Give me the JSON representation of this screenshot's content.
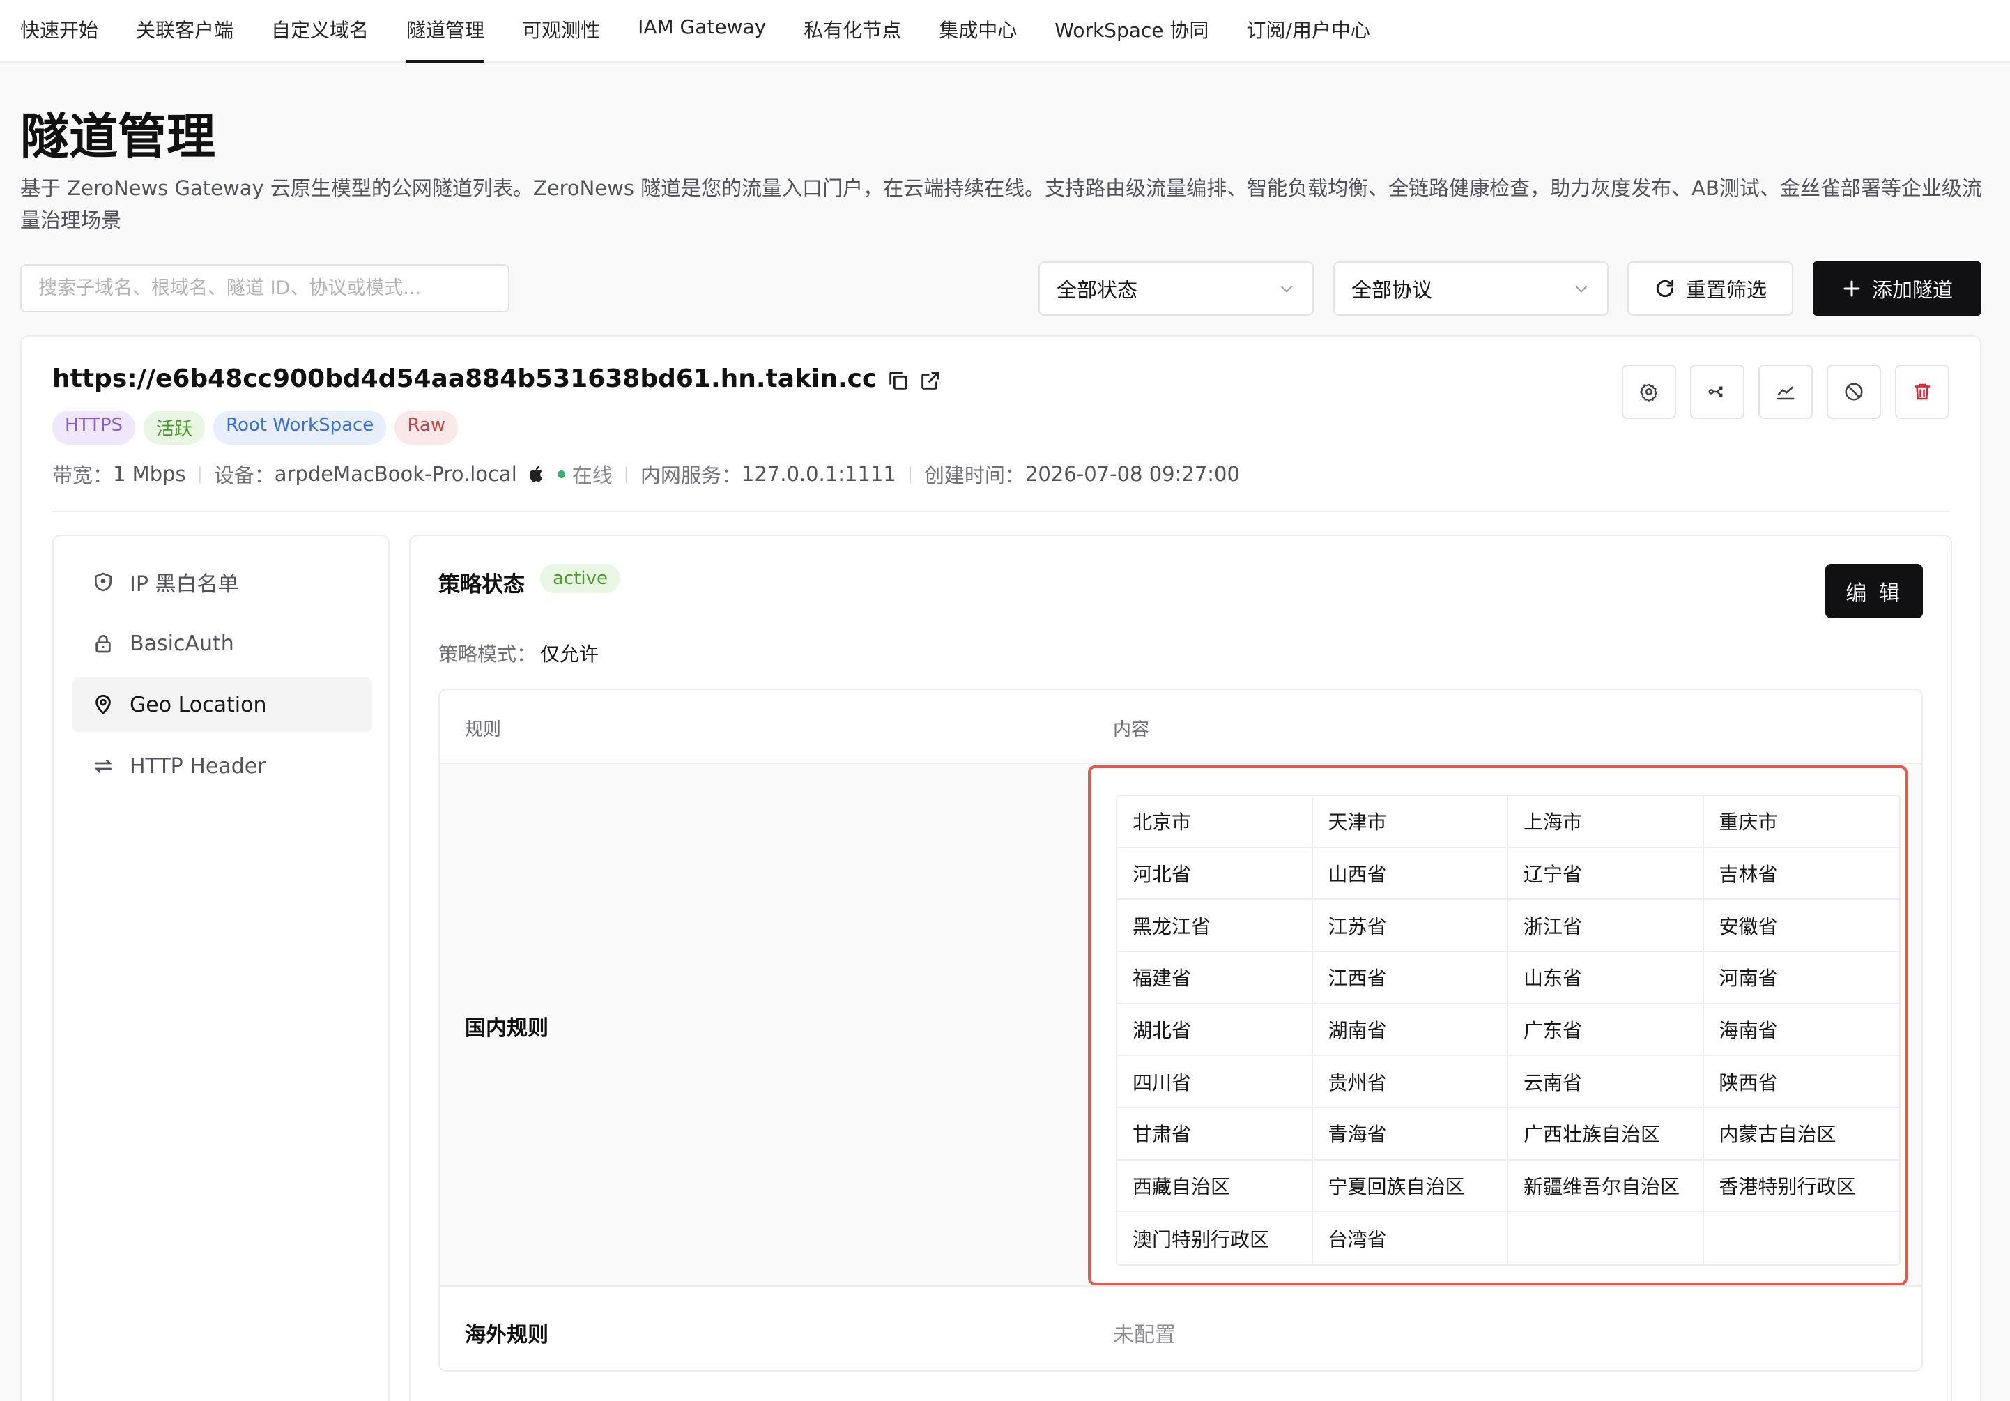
{
  "nav": {
    "items": [
      "快速开始",
      "关联客户端",
      "自定义域名",
      "隧道管理",
      "可观测性",
      "IAM Gateway",
      "私有化节点",
      "集成中心",
      "WorkSpace 协同",
      "订阅/用户中心"
    ],
    "active_index": 3
  },
  "page": {
    "title": "隧道管理",
    "description": "基于 ZeroNews Gateway 云原生模型的公网隧道列表。ZeroNews 隧道是您的流量入口门户，在云端持续在线。支持路由级流量编排、智能负载均衡、全链路健康检查，助力灰度发布、AB测试、金丝雀部署等企业级流量治理场景"
  },
  "toolbar": {
    "search_placeholder": "搜索子域名、根域名、隧道 ID、协议或模式...",
    "status_select": "全部状态",
    "protocol_select": "全部协议",
    "reset_label": "重置筛选",
    "add_label": "添加隧道"
  },
  "tunnel": {
    "url": "https://e6b48cc900bd4d54aa884b531638bd61.hn.takin.cc",
    "tags": [
      "HTTPS",
      "活跃",
      "Root WorkSpace",
      "Raw"
    ],
    "bandwidth_label": "带宽：",
    "bandwidth": "1 Mbps",
    "device_label": "设备：",
    "device": "arpdeMacBook-Pro.local",
    "status": "在线",
    "service_label": "内网服务：",
    "service": "127.0.0.1:1111",
    "created_label": "创建时间：",
    "created": "2026-07-08 09:27:00"
  },
  "side_menu": {
    "items": [
      "IP 黑白名单",
      "BasicAuth",
      "Geo Location",
      "HTTP Header"
    ],
    "selected_index": 2
  },
  "policy": {
    "title": "策略状态",
    "status": "active",
    "edit_label": "编 辑",
    "mode_label": "策略模式：",
    "mode": "仅允许",
    "columns": [
      "规则",
      "内容"
    ],
    "domestic_label": "国内规则",
    "overseas_label": "海外规则",
    "overseas_value": "未配置",
    "regions": [
      "北京市",
      "天津市",
      "上海市",
      "重庆市",
      "河北省",
      "山西省",
      "辽宁省",
      "吉林省",
      "黑龙江省",
      "江苏省",
      "浙江省",
      "安徽省",
      "福建省",
      "江西省",
      "山东省",
      "河南省",
      "湖北省",
      "湖南省",
      "广东省",
      "海南省",
      "四川省",
      "贵州省",
      "云南省",
      "陕西省",
      "甘肃省",
      "青海省",
      "广西壮族自治区",
      "内蒙古自治区",
      "西藏自治区",
      "宁夏回族自治区",
      "新疆维吾尔自治区",
      "香港特别行政区",
      "澳门特别行政区",
      "台湾省"
    ]
  },
  "colors": {
    "primary": "#111113",
    "highlight_border": "#e45a4f",
    "online": "#3cb371",
    "danger": "#e11d2e"
  }
}
